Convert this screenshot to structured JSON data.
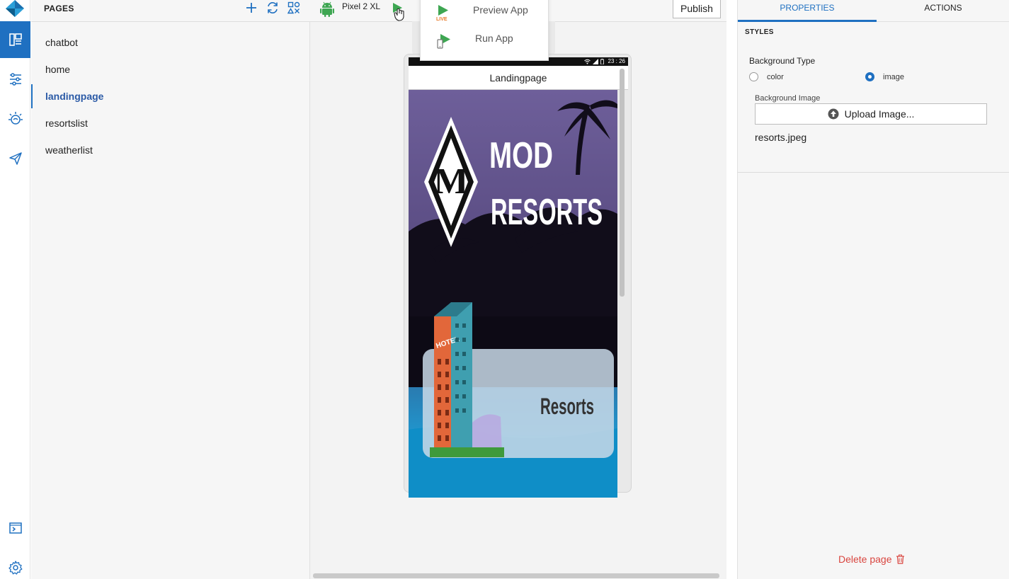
{
  "pages_panel": {
    "title": "PAGES",
    "items": [
      {
        "label": "chatbot",
        "active": false
      },
      {
        "label": "home",
        "active": false
      },
      {
        "label": "landingpage",
        "active": true
      },
      {
        "label": "resortslist",
        "active": false
      },
      {
        "label": "weatherlist",
        "active": false
      }
    ]
  },
  "toolbar": {
    "device": "Pixel 2 XL",
    "publish_label": "Publish"
  },
  "run_menu": {
    "items": [
      {
        "label": "Preview App",
        "icon": "live-play-icon"
      },
      {
        "label": "Run App",
        "icon": "device-play-icon"
      }
    ]
  },
  "phone": {
    "status_time": "23 : 26",
    "page_title": "Landingpage",
    "hero_line1": "MOD",
    "hero_line2": "RESORTS",
    "monogram": "M",
    "card_label": "Resorts",
    "hotel_sign": "HOTEL"
  },
  "properties": {
    "tab_properties": "PROPERTIES",
    "tab_actions": "ACTIONS",
    "section": "STYLES",
    "background_type_label": "Background Type",
    "options": [
      {
        "label": "color",
        "checked": false
      },
      {
        "label": "image",
        "checked": true
      }
    ],
    "background_image_label": "Background Image",
    "upload_label": "Upload Image...",
    "filename": "resorts.jpeg",
    "delete_label": "Delete page"
  },
  "colors": {
    "accent": "#1f70c1",
    "danger": "#d9453f",
    "android_green": "#3ea652"
  }
}
